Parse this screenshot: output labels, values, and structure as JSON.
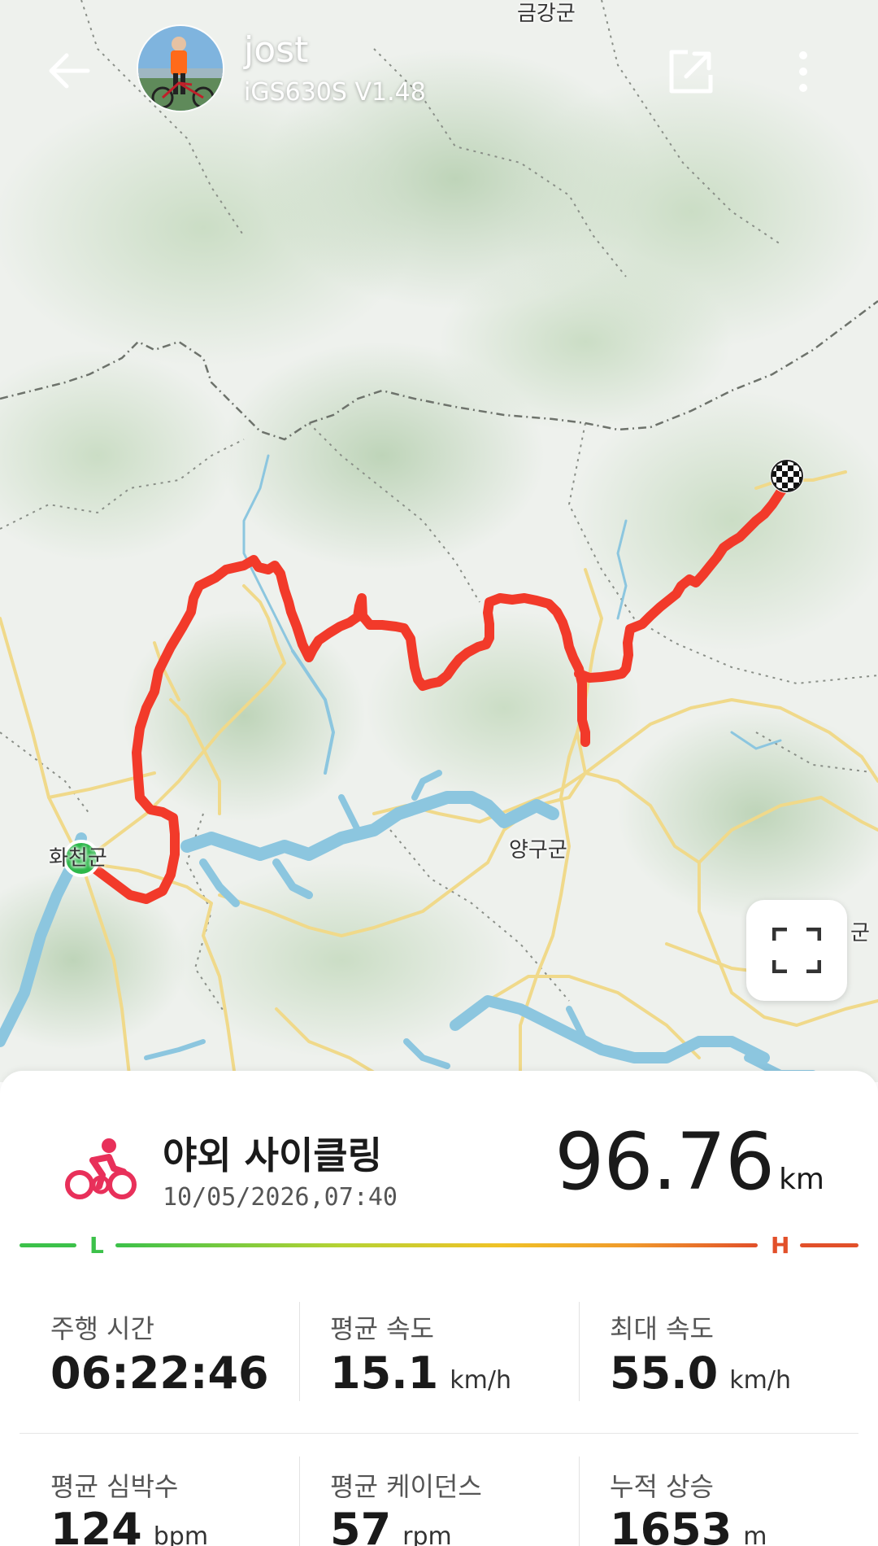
{
  "header": {
    "user_name": "jost",
    "device": "iGS630S  V1.48"
  },
  "map": {
    "place_labels": {
      "top": "금강군",
      "left": "화천군",
      "center": "양구군",
      "right_edge": "군"
    },
    "route_color": "#f23a2a",
    "start_marker_color": "#2db84a"
  },
  "activity": {
    "name": "야외 사이클링",
    "datetime": "10/05/2026,07:40",
    "distance": "96.76",
    "distance_unit": "km",
    "icon": "cycling-icon",
    "icon_color": "#e8305a"
  },
  "intensity": {
    "low_label": "L",
    "high_label": "H"
  },
  "stats": [
    {
      "label": "주행 시간",
      "value": "06:22:46",
      "unit": ""
    },
    {
      "label": "평균 속도",
      "value": "15.1",
      "unit": "km/h"
    },
    {
      "label": "최대 속도",
      "value": "55.0",
      "unit": "km/h"
    },
    {
      "label": "평균 심박수",
      "value": "124",
      "unit": "bpm"
    },
    {
      "label": "평균 케이던스",
      "value": "57",
      "unit": "rpm"
    },
    {
      "label": "누적 상승",
      "value": "1653",
      "unit": "m"
    }
  ]
}
